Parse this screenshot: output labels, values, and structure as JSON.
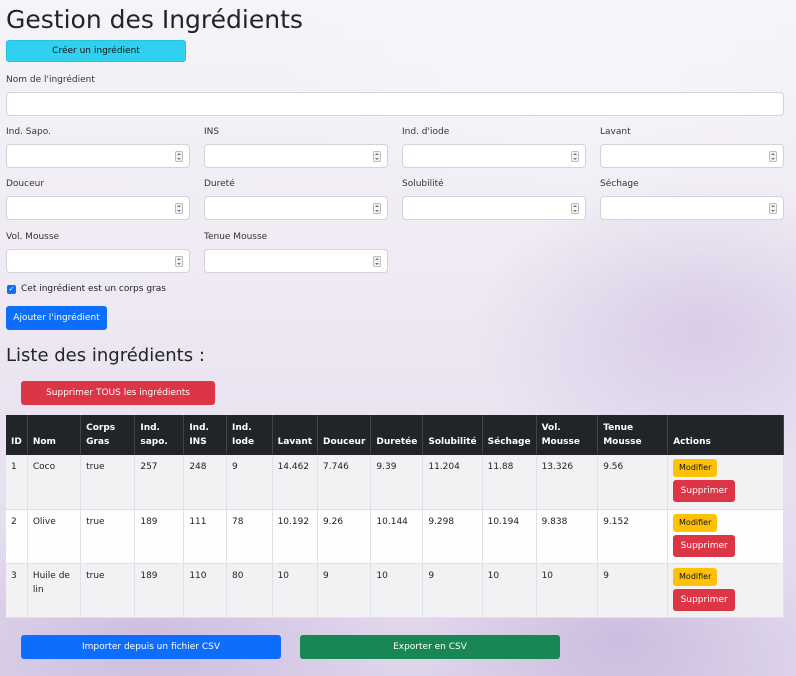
{
  "page": {
    "title": "Gestion des Ingrédients",
    "create_button": "Créer un ingrédient",
    "list_title": "Liste des ingrédients :",
    "delete_all_button": "Supprimer TOUS les ingrédients",
    "import_button": "Importer depuis un fichier CSV",
    "export_button": "Exporter en CSV"
  },
  "form": {
    "name_label": "Nom de l'ingrédient",
    "name_value": "",
    "fields": [
      {
        "label": "Ind. Sapo.",
        "value": ""
      },
      {
        "label": "INS",
        "value": ""
      },
      {
        "label": "Ind. d'iode",
        "value": ""
      },
      {
        "label": "Lavant",
        "value": ""
      },
      {
        "label": "Douceur",
        "value": ""
      },
      {
        "label": "Dureté",
        "value": ""
      },
      {
        "label": "Solubilité",
        "value": ""
      },
      {
        "label": "Séchage",
        "value": ""
      },
      {
        "label": "Vol. Mousse",
        "value": ""
      },
      {
        "label": "Tenue Mousse",
        "value": ""
      }
    ],
    "fat_checkbox_checked": true,
    "fat_checkbox_label": "Cet ingrédient est un corps gras",
    "submit_button": "Ajouter l'ingrédient"
  },
  "table": {
    "headers": {
      "id": "ID",
      "nom": "Nom",
      "corps_gras": [
        "Corps",
        "Gras"
      ],
      "ind_sapo": [
        "Ind.",
        "sapo."
      ],
      "ind_ins": [
        "Ind.",
        "INS"
      ],
      "ind_iode": [
        "Ind.",
        "Iode"
      ],
      "lavant": "Lavant",
      "douceur": "Douceur",
      "durete": "Duretée",
      "solubilite": "Solubilité",
      "sechage": "Séchage",
      "vol_mousse": [
        "Vol.",
        "Mousse"
      ],
      "tenue_mousse": [
        "Tenue",
        "Mousse"
      ],
      "actions": "Actions"
    },
    "edit_label": "Modifier",
    "delete_label": "Supprimer",
    "rows": [
      {
        "id": "1",
        "nom": "Coco",
        "corps_gras": "true",
        "sapo": "257",
        "ins": "248",
        "iode": "9",
        "lavant": "14.462",
        "douceur": "7.746",
        "durete": "9.39",
        "solubilite": "11.204",
        "sechage": "11.88",
        "vol_mousse": "13.326",
        "tenue_mousse": "9.56"
      },
      {
        "id": "2",
        "nom": "Olive",
        "corps_gras": "true",
        "sapo": "189",
        "ins": "111",
        "iode": "78",
        "lavant": "10.192",
        "douceur": "9.26",
        "durete": "10.144",
        "solubilite": "9.298",
        "sechage": "10.194",
        "vol_mousse": "9.838",
        "tenue_mousse": "9.152"
      },
      {
        "id": "3",
        "nom": "Huile de lin",
        "corps_gras": "true",
        "sapo": "189",
        "ins": "110",
        "iode": "80",
        "lavant": "10",
        "douceur": "9",
        "durete": "10",
        "solubilite": "9",
        "sechage": "10",
        "vol_mousse": "10",
        "tenue_mousse": "9"
      }
    ]
  },
  "colors": {
    "primary": "#0d6efd",
    "info": "#2fd0f0",
    "danger": "#dc3545",
    "warning": "#ffc107",
    "success": "#198754",
    "table_header": "#212529"
  }
}
